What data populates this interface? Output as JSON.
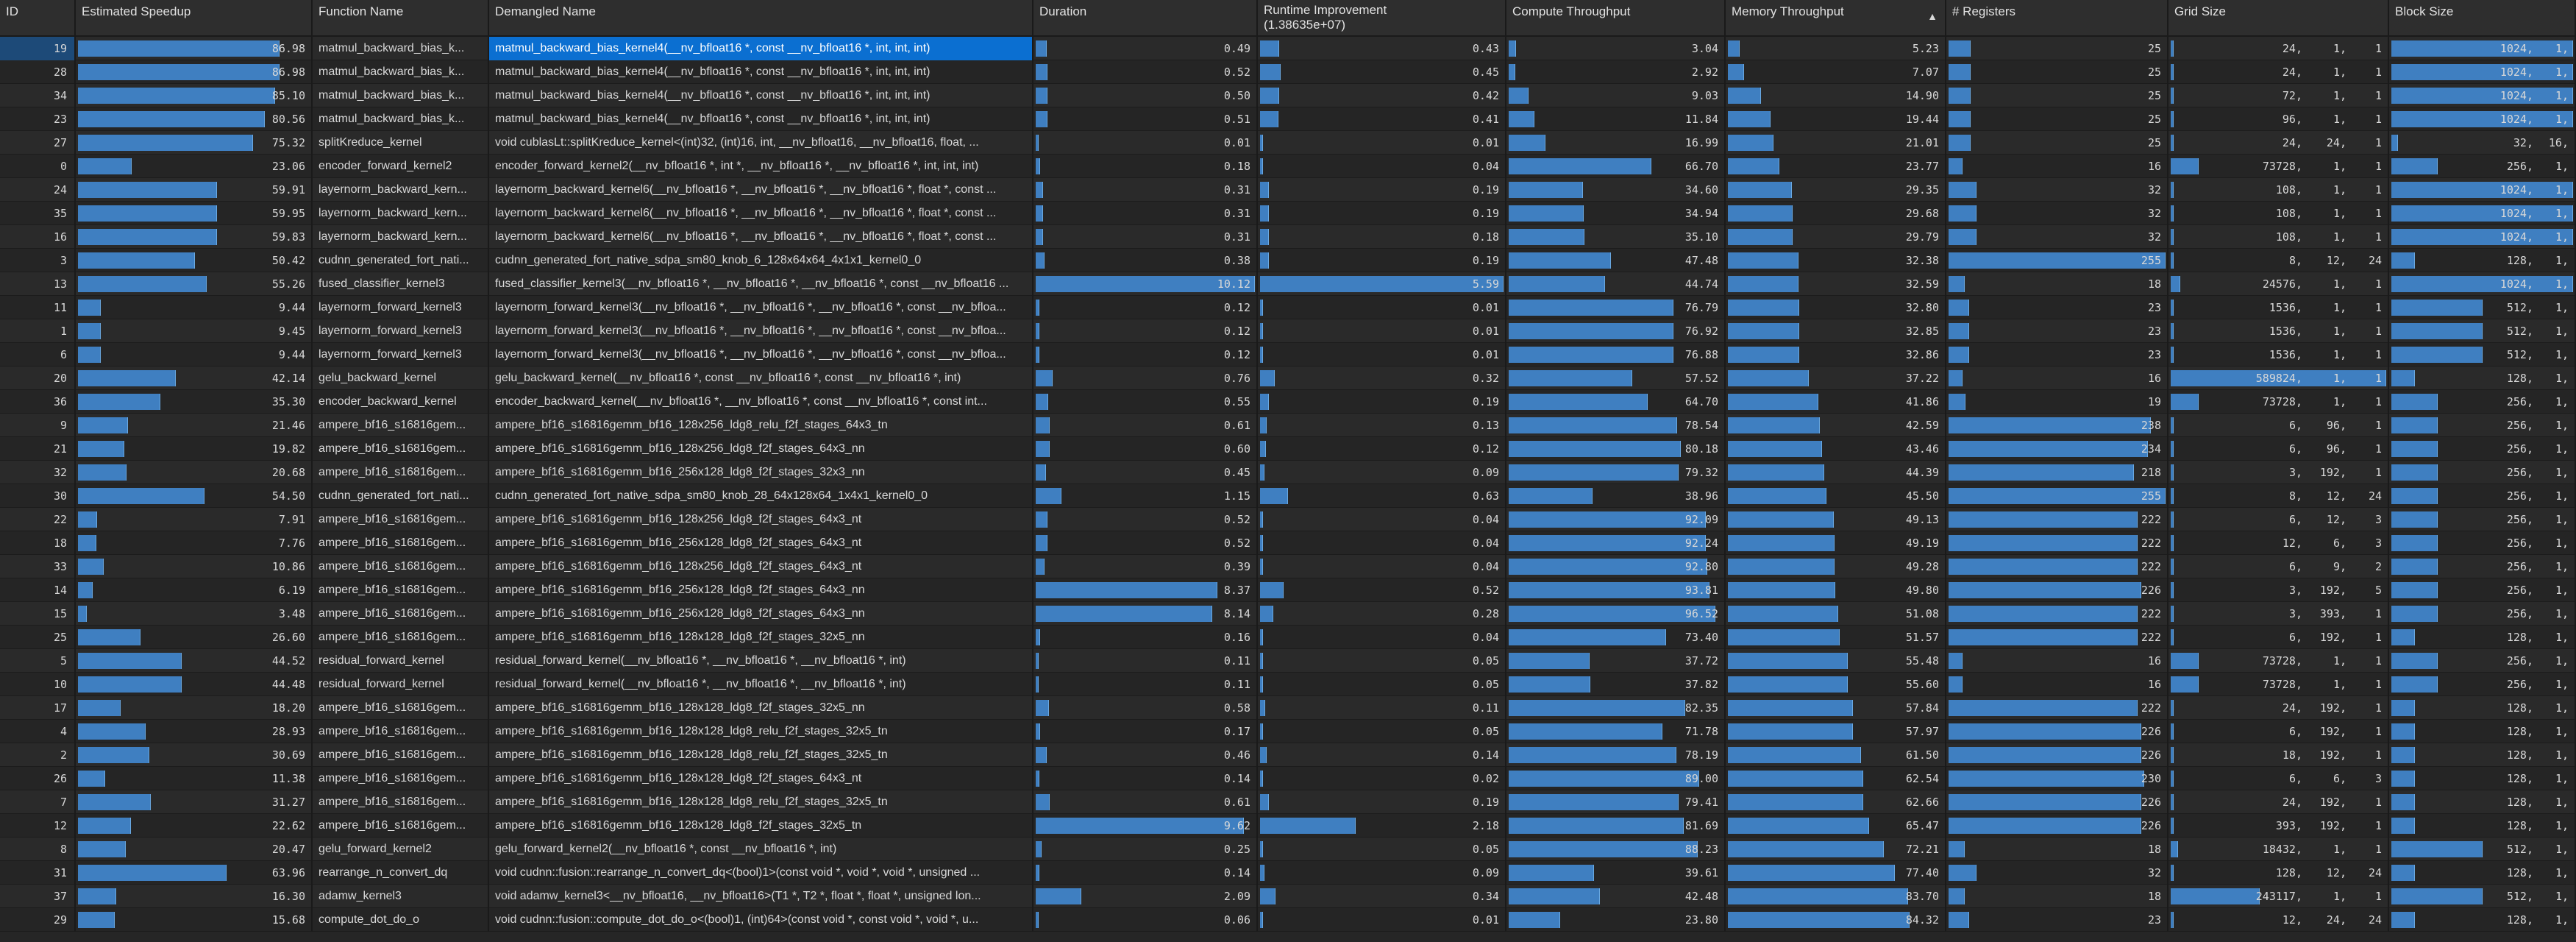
{
  "columns": {
    "id": "ID",
    "speedup": "Estimated Speedup",
    "func": "Function Name",
    "demangled": "Demangled Name",
    "duration": "Duration",
    "runtime": "Runtime Improvement",
    "runtime_sub": "(1.38635e+07)",
    "compute": "Compute Throughput",
    "memory": "Memory Throughput",
    "registers": "# Registers",
    "grid": "Grid Size",
    "block": "Block Size"
  },
  "sort": {
    "column": "memory",
    "icon": "sort-ascending-icon",
    "glyph": "▲"
  },
  "selected_row": 0,
  "accent_color": "#3f7fc1",
  "selection_color": "#0b6fd1",
  "rows": [
    {
      "id": "19",
      "speedup": "86.98",
      "func": "matmul_backward_bias_k...",
      "dem": "matmul_backward_bias_kernel4(__nv_bfloat16 *, const __nv_bfloat16 *, int, int, int)",
      "dur": "0.49",
      "rt": "0.43",
      "ct": "3.04",
      "mt": "5.23",
      "reg": "25",
      "grid": [
        "24,",
        "1,",
        "1"
      ],
      "block": [
        "1024,",
        "1,"
      ]
    },
    {
      "id": "28",
      "speedup": "86.98",
      "func": "matmul_backward_bias_k...",
      "dem": "matmul_backward_bias_kernel4(__nv_bfloat16 *, const __nv_bfloat16 *, int, int, int)",
      "dur": "0.52",
      "rt": "0.45",
      "ct": "2.92",
      "mt": "7.07",
      "reg": "25",
      "grid": [
        "24,",
        "1,",
        "1"
      ],
      "block": [
        "1024,",
        "1,"
      ]
    },
    {
      "id": "34",
      "speedup": "85.10",
      "func": "matmul_backward_bias_k...",
      "dem": "matmul_backward_bias_kernel4(__nv_bfloat16 *, const __nv_bfloat16 *, int, int, int)",
      "dur": "0.50",
      "rt": "0.42",
      "ct": "9.03",
      "mt": "14.90",
      "reg": "25",
      "grid": [
        "72,",
        "1,",
        "1"
      ],
      "block": [
        "1024,",
        "1,"
      ]
    },
    {
      "id": "23",
      "speedup": "80.56",
      "func": "matmul_backward_bias_k...",
      "dem": "matmul_backward_bias_kernel4(__nv_bfloat16 *, const __nv_bfloat16 *, int, int, int)",
      "dur": "0.51",
      "rt": "0.41",
      "ct": "11.84",
      "mt": "19.44",
      "reg": "25",
      "grid": [
        "96,",
        "1,",
        "1"
      ],
      "block": [
        "1024,",
        "1,"
      ]
    },
    {
      "id": "27",
      "speedup": "75.32",
      "func": "splitKreduce_kernel",
      "dem": "void cublasLt::splitKreduce_kernel<(int)32, (int)16, int, __nv_bfloat16, __nv_bfloat16, float, ...",
      "dur": "0.01",
      "rt": "0.01",
      "ct": "16.99",
      "mt": "21.01",
      "reg": "25",
      "grid": [
        "24,",
        "24,",
        "1"
      ],
      "block": [
        "32,",
        "16,"
      ]
    },
    {
      "id": "0",
      "speedup": "23.06",
      "func": "encoder_forward_kernel2",
      "dem": "encoder_forward_kernel2(__nv_bfloat16 *, int *, __nv_bfloat16 *, __nv_bfloat16 *, int, int, int)",
      "dur": "0.18",
      "rt": "0.04",
      "ct": "66.70",
      "mt": "23.77",
      "reg": "16",
      "grid": [
        "73728,",
        "1,",
        "1"
      ],
      "block": [
        "256,",
        "1,"
      ]
    },
    {
      "id": "24",
      "speedup": "59.91",
      "func": "layernorm_backward_kern...",
      "dem": "layernorm_backward_kernel6(__nv_bfloat16 *, __nv_bfloat16 *, __nv_bfloat16 *, float *, const ...",
      "dur": "0.31",
      "rt": "0.19",
      "ct": "34.60",
      "mt": "29.35",
      "reg": "32",
      "grid": [
        "108,",
        "1,",
        "1"
      ],
      "block": [
        "1024,",
        "1,"
      ]
    },
    {
      "id": "35",
      "speedup": "59.95",
      "func": "layernorm_backward_kern...",
      "dem": "layernorm_backward_kernel6(__nv_bfloat16 *, __nv_bfloat16 *, __nv_bfloat16 *, float *, const ...",
      "dur": "0.31",
      "rt": "0.19",
      "ct": "34.94",
      "mt": "29.68",
      "reg": "32",
      "grid": [
        "108,",
        "1,",
        "1"
      ],
      "block": [
        "1024,",
        "1,"
      ]
    },
    {
      "id": "16",
      "speedup": "59.83",
      "func": "layernorm_backward_kern...",
      "dem": "layernorm_backward_kernel6(__nv_bfloat16 *, __nv_bfloat16 *, __nv_bfloat16 *, float *, const ...",
      "dur": "0.31",
      "rt": "0.18",
      "ct": "35.10",
      "mt": "29.79",
      "reg": "32",
      "grid": [
        "108,",
        "1,",
        "1"
      ],
      "block": [
        "1024,",
        "1,"
      ]
    },
    {
      "id": "3",
      "speedup": "50.42",
      "func": "cudnn_generated_fort_nati...",
      "dem": "cudnn_generated_fort_native_sdpa_sm80_knob_6_128x64x64_4x1x1_kernel0_0",
      "dur": "0.38",
      "rt": "0.19",
      "ct": "47.48",
      "mt": "32.38",
      "reg": "255",
      "grid": [
        "8,",
        "12,",
        "24"
      ],
      "block": [
        "128,",
        "1,"
      ]
    },
    {
      "id": "13",
      "speedup": "55.26",
      "func": "fused_classifier_kernel3",
      "dem": "fused_classifier_kernel3(__nv_bfloat16 *, __nv_bfloat16 *, __nv_bfloat16 *, const __nv_bfloat16 ...",
      "dur": "10.12",
      "rt": "5.59",
      "ct": "44.74",
      "mt": "32.59",
      "reg": "18",
      "grid": [
        "24576,",
        "1,",
        "1"
      ],
      "block": [
        "1024,",
        "1,"
      ]
    },
    {
      "id": "11",
      "speedup": "9.44",
      "func": "layernorm_forward_kernel3",
      "dem": "layernorm_forward_kernel3(__nv_bfloat16 *, __nv_bfloat16 *, __nv_bfloat16 *, const __nv_bfloa...",
      "dur": "0.12",
      "rt": "0.01",
      "ct": "76.79",
      "mt": "32.80",
      "reg": "23",
      "grid": [
        "1536,",
        "1,",
        "1"
      ],
      "block": [
        "512,",
        "1,"
      ]
    },
    {
      "id": "1",
      "speedup": "9.45",
      "func": "layernorm_forward_kernel3",
      "dem": "layernorm_forward_kernel3(__nv_bfloat16 *, __nv_bfloat16 *, __nv_bfloat16 *, const __nv_bfloa...",
      "dur": "0.12",
      "rt": "0.01",
      "ct": "76.92",
      "mt": "32.85",
      "reg": "23",
      "grid": [
        "1536,",
        "1,",
        "1"
      ],
      "block": [
        "512,",
        "1,"
      ]
    },
    {
      "id": "6",
      "speedup": "9.44",
      "func": "layernorm_forward_kernel3",
      "dem": "layernorm_forward_kernel3(__nv_bfloat16 *, __nv_bfloat16 *, __nv_bfloat16 *, const __nv_bfloa...",
      "dur": "0.12",
      "rt": "0.01",
      "ct": "76.88",
      "mt": "32.86",
      "reg": "23",
      "grid": [
        "1536,",
        "1,",
        "1"
      ],
      "block": [
        "512,",
        "1,"
      ]
    },
    {
      "id": "20",
      "speedup": "42.14",
      "func": "gelu_backward_kernel",
      "dem": "gelu_backward_kernel(__nv_bfloat16 *, const __nv_bfloat16 *, const __nv_bfloat16 *, int)",
      "dur": "0.76",
      "rt": "0.32",
      "ct": "57.52",
      "mt": "37.22",
      "reg": "16",
      "grid": [
        "589824,",
        "1,",
        "1"
      ],
      "block": [
        "128,",
        "1,"
      ]
    },
    {
      "id": "36",
      "speedup": "35.30",
      "func": "encoder_backward_kernel",
      "dem": "encoder_backward_kernel(__nv_bfloat16 *, __nv_bfloat16 *, const __nv_bfloat16 *, const int...",
      "dur": "0.55",
      "rt": "0.19",
      "ct": "64.70",
      "mt": "41.86",
      "reg": "19",
      "grid": [
        "73728,",
        "1,",
        "1"
      ],
      "block": [
        "256,",
        "1,"
      ]
    },
    {
      "id": "9",
      "speedup": "21.46",
      "func": "ampere_bf16_s16816gem...",
      "dem": "ampere_bf16_s16816gemm_bf16_128x256_ldg8_relu_f2f_stages_64x3_tn",
      "dur": "0.61",
      "rt": "0.13",
      "ct": "78.54",
      "mt": "42.59",
      "reg": "238",
      "grid": [
        "6,",
        "96,",
        "1"
      ],
      "block": [
        "256,",
        "1,"
      ]
    },
    {
      "id": "21",
      "speedup": "19.82",
      "func": "ampere_bf16_s16816gem...",
      "dem": "ampere_bf16_s16816gemm_bf16_128x256_ldg8_f2f_stages_64x3_nn",
      "dur": "0.60",
      "rt": "0.12",
      "ct": "80.18",
      "mt": "43.46",
      "reg": "234",
      "grid": [
        "6,",
        "96,",
        "1"
      ],
      "block": [
        "256,",
        "1,"
      ]
    },
    {
      "id": "32",
      "speedup": "20.68",
      "func": "ampere_bf16_s16816gem...",
      "dem": "ampere_bf16_s16816gemm_bf16_256x128_ldg8_f2f_stages_32x3_nn",
      "dur": "0.45",
      "rt": "0.09",
      "ct": "79.32",
      "mt": "44.39",
      "reg": "218",
      "grid": [
        "3,",
        "192,",
        "1"
      ],
      "block": [
        "256,",
        "1,"
      ]
    },
    {
      "id": "30",
      "speedup": "54.50",
      "func": "cudnn_generated_fort_nati...",
      "dem": "cudnn_generated_fort_native_sdpa_sm80_knob_28_64x128x64_1x4x1_kernel0_0",
      "dur": "1.15",
      "rt": "0.63",
      "ct": "38.96",
      "mt": "45.50",
      "reg": "255",
      "grid": [
        "8,",
        "12,",
        "24"
      ],
      "block": [
        "256,",
        "1,"
      ]
    },
    {
      "id": "22",
      "speedup": "7.91",
      "func": "ampere_bf16_s16816gem...",
      "dem": "ampere_bf16_s16816gemm_bf16_128x256_ldg8_f2f_stages_64x3_nt",
      "dur": "0.52",
      "rt": "0.04",
      "ct": "92.09",
      "mt": "49.13",
      "reg": "222",
      "grid": [
        "6,",
        "12,",
        "3"
      ],
      "block": [
        "256,",
        "1,"
      ]
    },
    {
      "id": "18",
      "speedup": "7.76",
      "func": "ampere_bf16_s16816gem...",
      "dem": "ampere_bf16_s16816gemm_bf16_256x128_ldg8_f2f_stages_64x3_nt",
      "dur": "0.52",
      "rt": "0.04",
      "ct": "92.24",
      "mt": "49.19",
      "reg": "222",
      "grid": [
        "12,",
        "6,",
        "3"
      ],
      "block": [
        "256,",
        "1,"
      ]
    },
    {
      "id": "33",
      "speedup": "10.86",
      "func": "ampere_bf16_s16816gem...",
      "dem": "ampere_bf16_s16816gemm_bf16_128x256_ldg8_f2f_stages_64x3_nt",
      "dur": "0.39",
      "rt": "0.04",
      "ct": "92.80",
      "mt": "49.28",
      "reg": "222",
      "grid": [
        "6,",
        "9,",
        "2"
      ],
      "block": [
        "256,",
        "1,"
      ]
    },
    {
      "id": "14",
      "speedup": "6.19",
      "func": "ampere_bf16_s16816gem...",
      "dem": "ampere_bf16_s16816gemm_bf16_256x128_ldg8_f2f_stages_64x3_nn",
      "dur": "8.37",
      "rt": "0.52",
      "ct": "93.81",
      "mt": "49.80",
      "reg": "226",
      "grid": [
        "3,",
        "192,",
        "5"
      ],
      "block": [
        "256,",
        "1,"
      ]
    },
    {
      "id": "15",
      "speedup": "3.48",
      "func": "ampere_bf16_s16816gem...",
      "dem": "ampere_bf16_s16816gemm_bf16_256x128_ldg8_f2f_stages_64x3_nn",
      "dur": "8.14",
      "rt": "0.28",
      "ct": "96.52",
      "mt": "51.08",
      "reg": "222",
      "grid": [
        "3,",
        "393,",
        "1"
      ],
      "block": [
        "256,",
        "1,"
      ]
    },
    {
      "id": "25",
      "speedup": "26.60",
      "func": "ampere_bf16_s16816gem...",
      "dem": "ampere_bf16_s16816gemm_bf16_128x128_ldg8_f2f_stages_32x5_nn",
      "dur": "0.16",
      "rt": "0.04",
      "ct": "73.40",
      "mt": "51.57",
      "reg": "222",
      "grid": [
        "6,",
        "192,",
        "1"
      ],
      "block": [
        "128,",
        "1,"
      ]
    },
    {
      "id": "5",
      "speedup": "44.52",
      "func": "residual_forward_kernel",
      "dem": "residual_forward_kernel(__nv_bfloat16 *, __nv_bfloat16 *, __nv_bfloat16 *, int)",
      "dur": "0.11",
      "rt": "0.05",
      "ct": "37.72",
      "mt": "55.48",
      "reg": "16",
      "grid": [
        "73728,",
        "1,",
        "1"
      ],
      "block": [
        "256,",
        "1,"
      ]
    },
    {
      "id": "10",
      "speedup": "44.48",
      "func": "residual_forward_kernel",
      "dem": "residual_forward_kernel(__nv_bfloat16 *, __nv_bfloat16 *, __nv_bfloat16 *, int)",
      "dur": "0.11",
      "rt": "0.05",
      "ct": "37.82",
      "mt": "55.60",
      "reg": "16",
      "grid": [
        "73728,",
        "1,",
        "1"
      ],
      "block": [
        "256,",
        "1,"
      ]
    },
    {
      "id": "17",
      "speedup": "18.20",
      "func": "ampere_bf16_s16816gem...",
      "dem": "ampere_bf16_s16816gemm_bf16_128x128_ldg8_f2f_stages_32x5_nn",
      "dur": "0.58",
      "rt": "0.11",
      "ct": "82.35",
      "mt": "57.84",
      "reg": "222",
      "grid": [
        "24,",
        "192,",
        "1"
      ],
      "block": [
        "128,",
        "1,"
      ]
    },
    {
      "id": "4",
      "speedup": "28.93",
      "func": "ampere_bf16_s16816gem...",
      "dem": "ampere_bf16_s16816gemm_bf16_128x128_ldg8_relu_f2f_stages_32x5_tn",
      "dur": "0.17",
      "rt": "0.05",
      "ct": "71.78",
      "mt": "57.97",
      "reg": "226",
      "grid": [
        "6,",
        "192,",
        "1"
      ],
      "block": [
        "128,",
        "1,"
      ]
    },
    {
      "id": "2",
      "speedup": "30.69",
      "func": "ampere_bf16_s16816gem...",
      "dem": "ampere_bf16_s16816gemm_bf16_128x128_ldg8_relu_f2f_stages_32x5_tn",
      "dur": "0.46",
      "rt": "0.14",
      "ct": "78.19",
      "mt": "61.50",
      "reg": "226",
      "grid": [
        "18,",
        "192,",
        "1"
      ],
      "block": [
        "128,",
        "1,"
      ]
    },
    {
      "id": "26",
      "speedup": "11.38",
      "func": "ampere_bf16_s16816gem...",
      "dem": "ampere_bf16_s16816gemm_bf16_128x128_ldg8_f2f_stages_64x3_nt",
      "dur": "0.14",
      "rt": "0.02",
      "ct": "89.00",
      "mt": "62.54",
      "reg": "230",
      "grid": [
        "6,",
        "6,",
        "3"
      ],
      "block": [
        "128,",
        "1,"
      ]
    },
    {
      "id": "7",
      "speedup": "31.27",
      "func": "ampere_bf16_s16816gem...",
      "dem": "ampere_bf16_s16816gemm_bf16_128x128_ldg8_relu_f2f_stages_32x5_tn",
      "dur": "0.61",
      "rt": "0.19",
      "ct": "79.41",
      "mt": "62.66",
      "reg": "226",
      "grid": [
        "24,",
        "192,",
        "1"
      ],
      "block": [
        "128,",
        "1,"
      ]
    },
    {
      "id": "12",
      "speedup": "22.62",
      "func": "ampere_bf16_s16816gem...",
      "dem": "ampere_bf16_s16816gemm_bf16_128x128_ldg8_f2f_stages_32x5_tn",
      "dur": "9.62",
      "rt": "2.18",
      "ct": "81.69",
      "mt": "65.47",
      "reg": "226",
      "grid": [
        "393,",
        "192,",
        "1"
      ],
      "block": [
        "128,",
        "1,"
      ]
    },
    {
      "id": "8",
      "speedup": "20.47",
      "func": "gelu_forward_kernel2",
      "dem": "gelu_forward_kernel2(__nv_bfloat16 *, const __nv_bfloat16 *, int)",
      "dur": "0.25",
      "rt": "0.05",
      "ct": "88.23",
      "mt": "72.21",
      "reg": "18",
      "grid": [
        "18432,",
        "1,",
        "1"
      ],
      "block": [
        "512,",
        "1,"
      ]
    },
    {
      "id": "31",
      "speedup": "63.96",
      "func": "rearrange_n_convert_dq",
      "dem": "void cudnn::fusion::rearrange_n_convert_dq<(bool)1>(const void *, void *, void *, unsigned ...",
      "dur": "0.14",
      "rt": "0.09",
      "ct": "39.61",
      "mt": "77.40",
      "reg": "32",
      "grid": [
        "128,",
        "12,",
        "24"
      ],
      "block": [
        "128,",
        "1,"
      ]
    },
    {
      "id": "37",
      "speedup": "16.30",
      "func": "adamw_kernel3",
      "dem": "void adamw_kernel3<__nv_bfloat16, __nv_bfloat16>(T1 *, T2 *, float *, float *, unsigned lon...",
      "dur": "2.09",
      "rt": "0.34",
      "ct": "42.48",
      "mt": "83.70",
      "reg": "18",
      "grid": [
        "243117,",
        "1,",
        "1"
      ],
      "block": [
        "512,",
        "1,"
      ]
    },
    {
      "id": "29",
      "speedup": "15.68",
      "func": "compute_dot_do_o",
      "dem": "void cudnn::fusion::compute_dot_do_o<(bool)1, (int)64>(const void *, const void *, void *, u...",
      "dur": "0.06",
      "rt": "0.01",
      "ct": "23.80",
      "mt": "84.32",
      "reg": "23",
      "grid": [
        "12,",
        "24,",
        "24"
      ],
      "block": [
        "128,",
        "1,"
      ]
    }
  ]
}
